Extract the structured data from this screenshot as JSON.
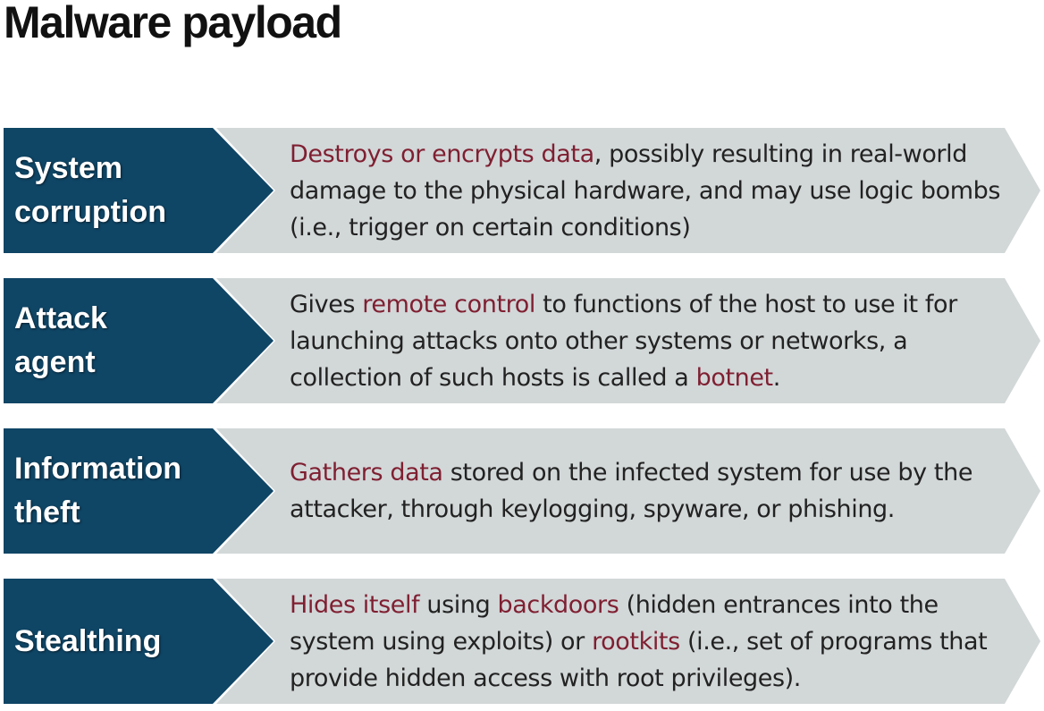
{
  "title": "Malware payload",
  "colors": {
    "chevron_dark": "#0f4565",
    "arrow_light": "#d2d7d8",
    "highlight": "#7f1f31",
    "text": "#222222"
  },
  "rows": [
    {
      "label": [
        "System",
        "corruption"
      ],
      "desc": [
        {
          "t": "Destroys or encrypts data",
          "hl": true
        },
        {
          "t": ", possibly resulting in real-world damage to the physical hardware, and may use logic bombs (i.e., trigger on certain conditions)",
          "hl": false
        }
      ]
    },
    {
      "label": [
        "Attack",
        "agent"
      ],
      "desc": [
        {
          "t": "Gives ",
          "hl": false
        },
        {
          "t": "remote control",
          "hl": true
        },
        {
          "t": " to functions of the host to use it for launching attacks onto other systems or networks, a collection of such hosts is called a ",
          "hl": false
        },
        {
          "t": "botnet",
          "hl": true
        },
        {
          "t": ".",
          "hl": false
        }
      ]
    },
    {
      "label": [
        "Information",
        "theft"
      ],
      "desc": [
        {
          "t": "Gathers data",
          "hl": true
        },
        {
          "t": " stored on the infected system for use by the attacker, through keylogging, spyware, or phishing.",
          "hl": false
        }
      ]
    },
    {
      "label": [
        "Stealthing"
      ],
      "desc": [
        {
          "t": "Hides itself",
          "hl": true
        },
        {
          "t": " using ",
          "hl": false
        },
        {
          "t": "backdoors",
          "hl": true
        },
        {
          "t": " (hidden entrances into the system using exploits) or ",
          "hl": false
        },
        {
          "t": "rootkits",
          "hl": true
        },
        {
          "t": " (i.e., set of programs that provide hidden access with root privileges).",
          "hl": false
        }
      ]
    }
  ]
}
